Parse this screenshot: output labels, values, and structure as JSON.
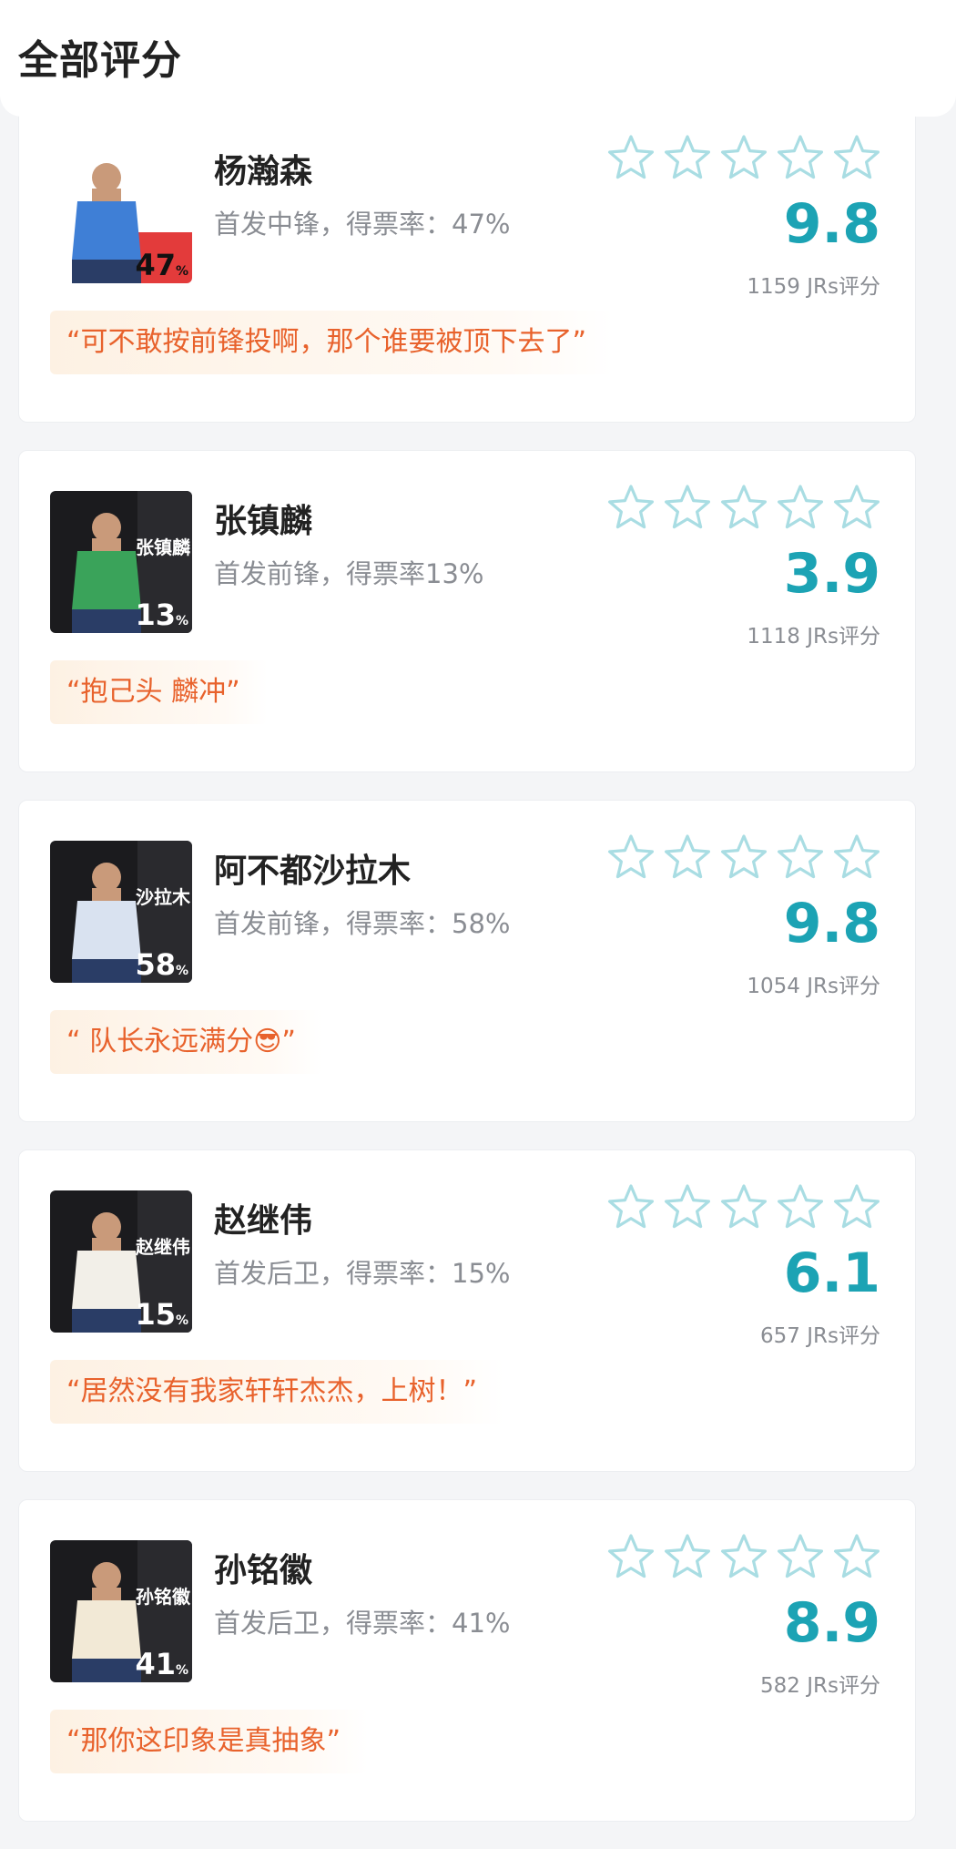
{
  "header": {
    "title": "全部评分"
  },
  "players": [
    {
      "name": "杨瀚森",
      "desc": "首发中锋，得票率：47%",
      "score": "9.8",
      "count": "1159 JRs评分",
      "quote": "“可不敢按前锋投啊，那个谁要被顶下去了”",
      "photo_number": "47",
      "photo_name": "",
      "photo_bg": "#ffffff",
      "jersey_color": "#3f7fd6"
    },
    {
      "name": "张镇麟",
      "desc": "首发前锋，得票率13%",
      "score": "3.9",
      "count": "1118 JRs评分",
      "quote": "“抱己头 麟冲”",
      "photo_number": "13",
      "photo_name": "张镇麟",
      "photo_bg": "#1b1b1e",
      "jersey_color": "#3aa35a"
    },
    {
      "name": "阿不都沙拉木",
      "desc": "首发前锋，得票率：58%",
      "score": "9.8",
      "count": "1054 JRs评分",
      "quote": "“ 队长永远满分😎”",
      "photo_number": "58",
      "photo_name": "沙拉木",
      "photo_bg": "#1b1b1e",
      "jersey_color": "#d9e2f0"
    },
    {
      "name": "赵继伟",
      "desc": "首发后卫，得票率：15%",
      "score": "6.1",
      "count": "657 JRs评分",
      "quote": "“居然没有我家轩轩杰杰，上树！”",
      "photo_number": "15",
      "photo_name": "赵继伟",
      "photo_bg": "#1b1b1e",
      "jersey_color": "#f2efe8"
    },
    {
      "name": "孙铭徽",
      "desc": "首发后卫，得票率：41%",
      "score": "8.9",
      "count": "582 JRs评分",
      "quote": "“那你这印象是真抽象”",
      "photo_number": "41",
      "photo_name": "孙铭徽",
      "photo_bg": "#1b1b1e",
      "jersey_color": "#f2e9d6"
    }
  ],
  "colors": {
    "accent": "#1ca3b4",
    "star_outline": "#a9dde3",
    "quote_text": "#e8622c",
    "quote_bg": "#fdf1e3"
  },
  "icons": {
    "star": "star-outline-icon"
  }
}
